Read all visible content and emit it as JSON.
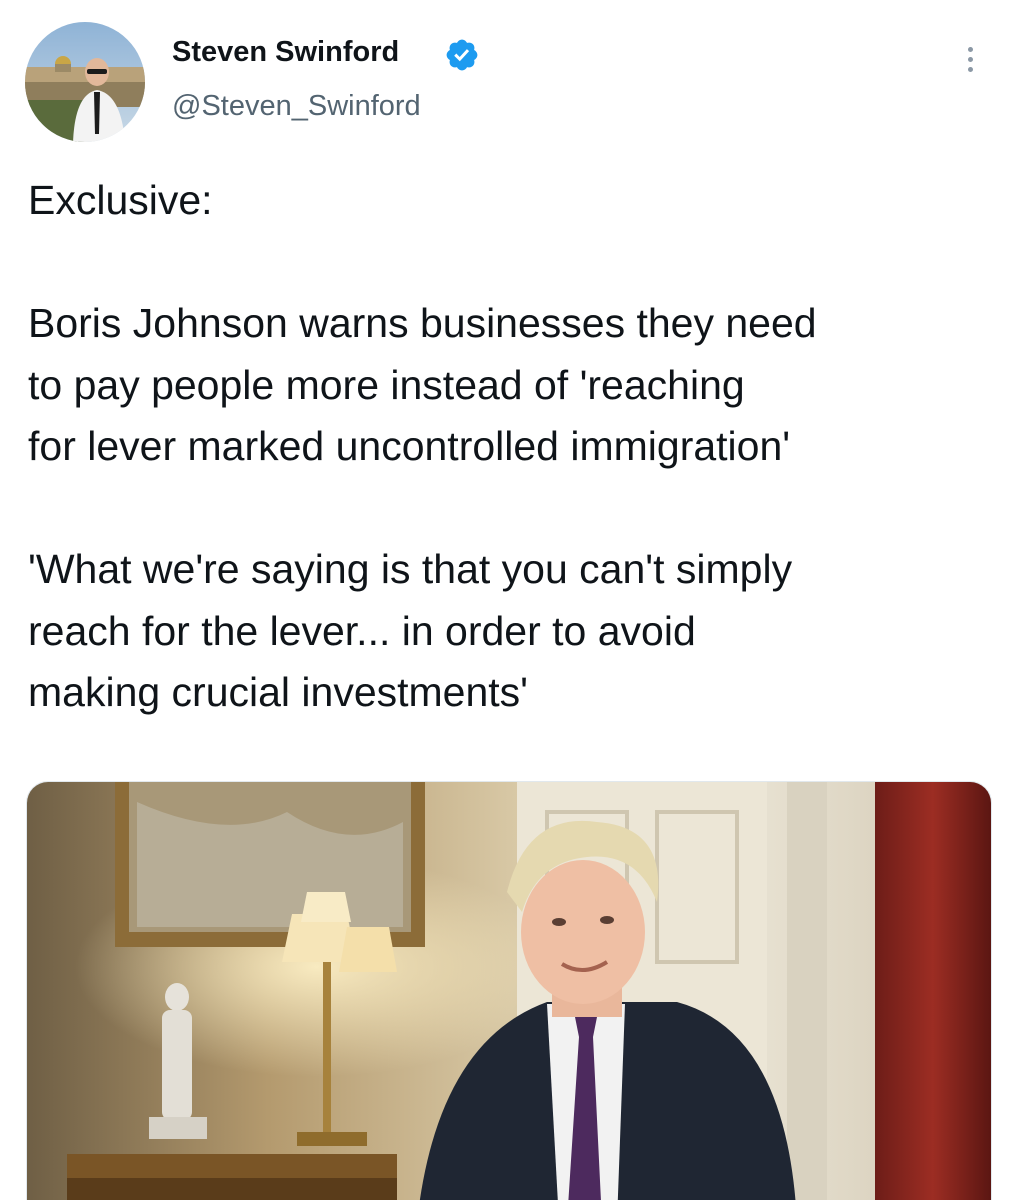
{
  "author": {
    "display_name": "Steven Swinford",
    "handle": "@Steven_Swinford",
    "verified": true
  },
  "tweet": {
    "line_1": "Exclusive:",
    "line_2": "Boris Johnson warns businesses they need",
    "line_3": "to pay people more instead of 'reaching",
    "line_4": "for lever marked uncontrolled immigration'",
    "line_5": "'What we're saying is that you can't simply",
    "line_6": "reach for the lever... in order to avoid",
    "line_7": "making crucial investments'"
  },
  "colors": {
    "text": "#0f1419",
    "secondary_text": "#536471",
    "verified_blue": "#1d9bf0"
  },
  "icons": {
    "verified": "verified-badge-icon",
    "more": "more-vertical-icon"
  }
}
